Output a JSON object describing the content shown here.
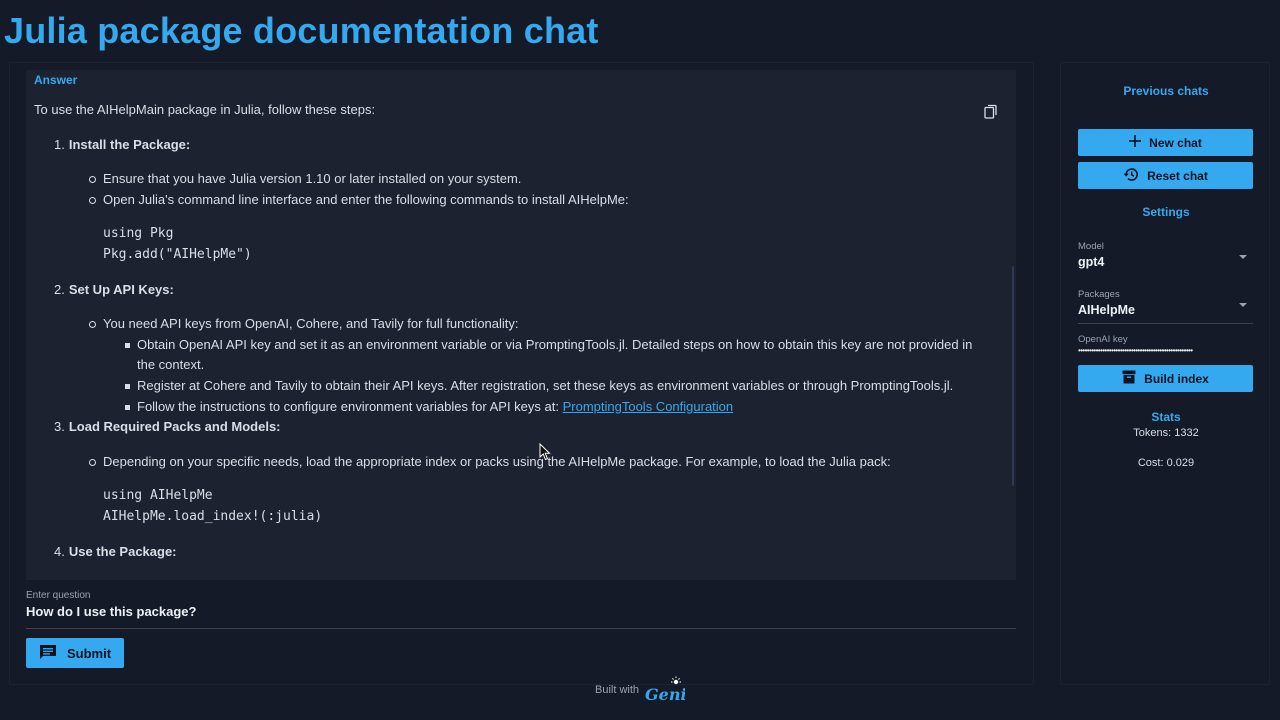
{
  "app": {
    "title": "Julia package documentation chat"
  },
  "answer": {
    "label": "Answer",
    "intro": "To use the AIHelpMain package in Julia, follow these steps:",
    "steps": [
      {
        "num": "1.",
        "title": "Install the Package:",
        "bullets": [
          "Ensure that you have Julia version 1.10 or later installed on your system.",
          "Open Julia's command line interface and enter the following commands to install AIHelpMe:"
        ],
        "code": [
          "using Pkg",
          "Pkg.add(\"AIHelpMe\")"
        ]
      },
      {
        "num": "2.",
        "title": "Set Up API Keys:",
        "bullet": "You need API keys from OpenAI, Cohere, and Tavily for full functionality:",
        "sub_bullets": [
          "Obtain OpenAI API key and set it as an environment variable or via PromptingTools.jl. Detailed steps on how to obtain this key are not provided in the context.",
          "Register at Cohere and Tavily to obtain their API keys. After registration, set these keys as environment variables or through PromptingTools.jl."
        ],
        "link_prefix": "Follow the instructions to configure environment variables for API keys at: ",
        "link_text": "PromptingTools Configuration"
      },
      {
        "num": "3.",
        "title": "Load Required Packs and Models:",
        "bullets": [
          "Depending on your specific needs, load the appropriate index or packs using the AIHelpMe package. For example, to load the Julia pack:"
        ],
        "code": [
          "using AIHelpMe",
          "AIHelpMe.load_index!(:julia)"
        ]
      },
      {
        "num": "4.",
        "title": "Use the Package:"
      }
    ]
  },
  "question": {
    "label": "Enter question",
    "value": "How do I use this package?"
  },
  "submit_label": "Submit",
  "sidebar": {
    "previous_chats": "Previous chats",
    "new_chat": "New chat",
    "reset_chat": "Reset chat",
    "settings": "Settings",
    "model_label": "Model",
    "model_value": "gpt4",
    "packages_label": "Packages",
    "packages_value": "AIHelpMe",
    "openai_key_label": "OpenAI key",
    "openai_key_mask": "••••••••••••••••••••••••••••••••••••••••••••••••••••",
    "build_index": "Build index",
    "stats_title": "Stats",
    "tokens": "Tokens:  1332",
    "cost": "Cost: 0.029"
  },
  "footer": {
    "built_with": "Built with",
    "logo": "Genie"
  },
  "colors": {
    "accent": "#35a9ef",
    "background": "#141a27",
    "panel": "#1c2230"
  },
  "icons": [
    "copy-icon",
    "plus-icon",
    "history-icon",
    "archive-icon",
    "message-icon",
    "mouse-cursor-icon"
  ]
}
